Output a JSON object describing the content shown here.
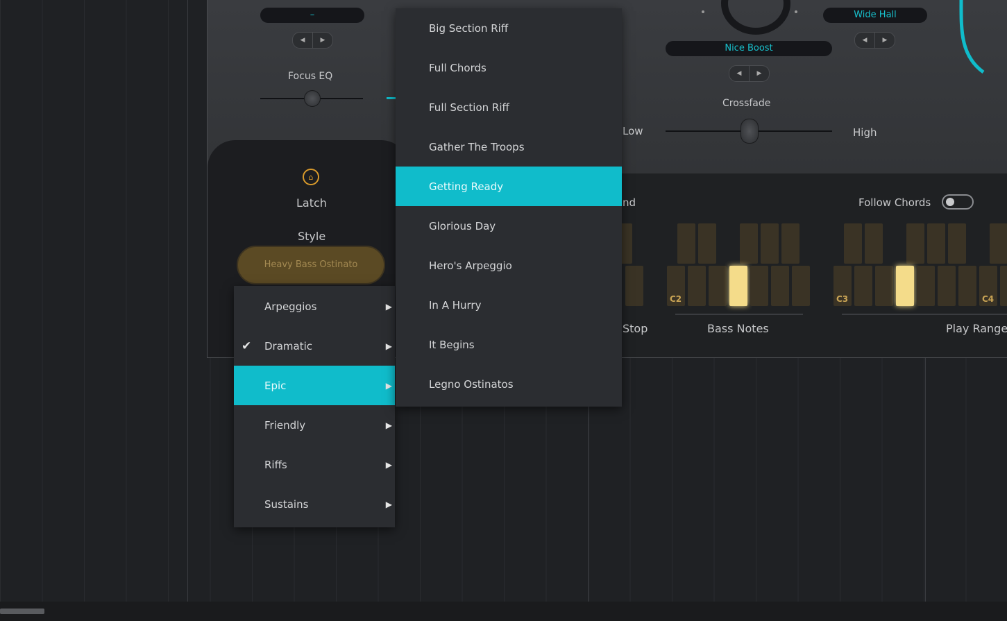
{
  "plugin": {
    "top_left_display": "–",
    "focus_eq_label": "Focus EQ",
    "preset_display": "Nice Boost",
    "reverb_display": "Wide Hall",
    "crossfade_label": "Crossfade",
    "crossfade_low": "Low",
    "crossfade_high": "High",
    "latch_label": "Latch",
    "style_label": "Style",
    "style_value": "Heavy Bass Ostinato",
    "partial_label_end": "nd",
    "follow_chords_label": "Follow Chords",
    "stop_label": "Stop",
    "bass_notes_label": "Bass Notes",
    "play_range_label": "Play Range",
    "key_c2": "C2",
    "key_c3": "C3",
    "key_c4": "C4"
  },
  "style_menu": {
    "items": [
      {
        "label": "Arpeggios",
        "has_submenu": true
      },
      {
        "label": "Dramatic",
        "has_submenu": true,
        "checked": true
      },
      {
        "label": "Epic",
        "has_submenu": true,
        "highlighted": true
      },
      {
        "label": "Friendly",
        "has_submenu": true
      },
      {
        "label": "Riffs",
        "has_submenu": true
      },
      {
        "label": "Sustains",
        "has_submenu": true
      }
    ]
  },
  "epic_submenu": {
    "items": [
      {
        "label": "Big Section Riff"
      },
      {
        "label": "Full Chords"
      },
      {
        "label": "Full Section Riff"
      },
      {
        "label": "Gather The Troops"
      },
      {
        "label": "Getting Ready",
        "highlighted": true
      },
      {
        "label": "Glorious Day"
      },
      {
        "label": "Hero's Arpeggio"
      },
      {
        "label": "In A Hurry"
      },
      {
        "label": "It Begins"
      },
      {
        "label": "Legno Ostinatos"
      }
    ]
  },
  "icons": {
    "lock": "lock-icon",
    "arrow_left": "arrow-left-icon",
    "arrow_right": "arrow-right-icon",
    "chevron_right": "chevron-right-icon",
    "check": "check-icon",
    "cursor": "mouse-cursor-icon"
  },
  "colors": {
    "accent": "#10bccb",
    "latch_orange": "#d99a2b",
    "key_lit": "#f4dc8a"
  }
}
